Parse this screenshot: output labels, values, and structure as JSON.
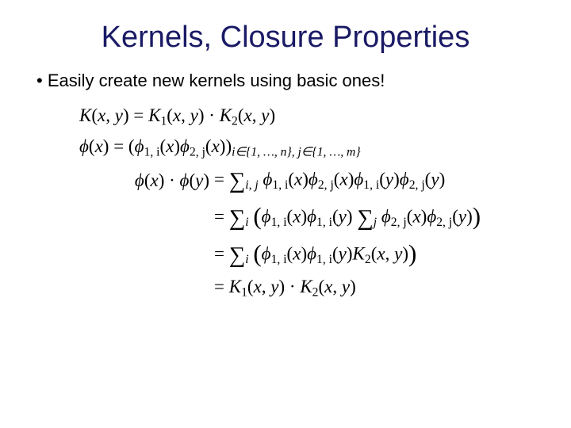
{
  "title": "Kernels, Closure Properties",
  "bullet1": "Easily create new kernels using basic ones!",
  "eq1_lhs": "K(x, y)",
  "eq1_rhs": "= K₁(x, y) · K₂(x, y)",
  "eq2_lhs": "ϕ(x)",
  "eq2_rhs_a": "= (ϕ",
  "eq2_rhs_b": "(x)ϕ",
  "eq2_rhs_c": "(x))",
  "eq2_sub1": "1, i",
  "eq2_sub2": "2, j",
  "eq2_idx": "i∈{1, …, n}, j∈{1, …, m}",
  "eq3_lhs": "ϕ(x) · ϕ(y)",
  "eq3_rhs_a": "= ",
  "eq3_rhs_b": " ϕ",
  "eq3_rhs_c": "(x)ϕ",
  "eq3_rhs_d": "(x)ϕ",
  "eq3_rhs_e": "(y)ϕ",
  "eq3_rhs_f": "(y)",
  "sum_ij": "i, j",
  "sum_i": "i",
  "sum_j": "j",
  "sub_1i": "1, i",
  "sub_2j": "2, j",
  "eq4_rhs_a": "= ",
  "eq4_rhs_open": "(",
  "eq4_rhs_b": "ϕ",
  "eq4_rhs_c": "(x)ϕ",
  "eq4_rhs_d": "(y) ",
  "eq4_rhs_e": " ϕ",
  "eq4_rhs_f": "(x)ϕ",
  "eq4_rhs_g": "(y)",
  "eq4_rhs_close": ")",
  "eq5_rhs_a": "= ",
  "eq5_rhs_b": "ϕ",
  "eq5_rhs_c": "(x)ϕ",
  "eq5_rhs_d": "(y)K",
  "eq5_rhs_e": "(x, y)",
  "sub_2": "2",
  "eq6_rhs": "= K₁(x, y) · K₂(x, y)",
  "sigma": "∑"
}
